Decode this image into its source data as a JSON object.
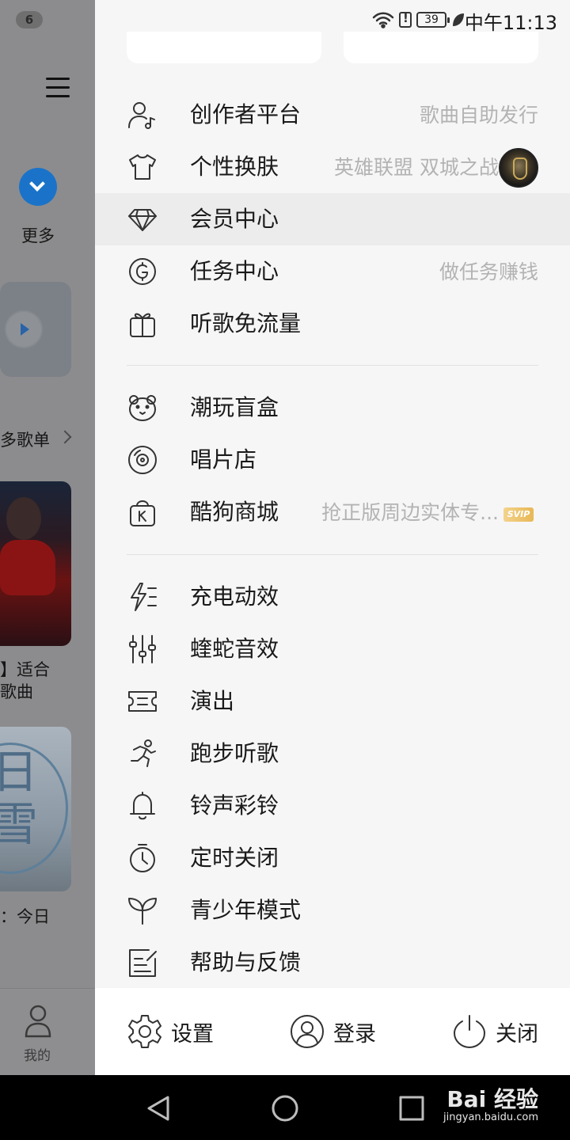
{
  "status_bar": {
    "time": "中午11:13",
    "battery": "39"
  },
  "background_app": {
    "notification_count": "6",
    "more_label": "更多",
    "playlist_header": "多歌单",
    "card1_caption": "】适合\n歌曲",
    "card2_glyphs": "日\n雪",
    "card2_caption": "：今日",
    "tab_me_label": "我的"
  },
  "drawer": {
    "menu_groups": [
      [
        {
          "label": "创作者平台",
          "hint": "歌曲自助发行",
          "icon": "creator-icon"
        },
        {
          "label": "个性换肤",
          "hint": "英雄联盟 双城之战",
          "icon": "shirt-icon",
          "avatar": true
        },
        {
          "label": "会员中心",
          "hint": "",
          "icon": "diamond-icon",
          "highlighted": true
        },
        {
          "label": "任务中心",
          "hint": "做任务赚钱",
          "icon": "coin-icon"
        },
        {
          "label": "听歌免流量",
          "hint": "",
          "icon": "gift-icon"
        }
      ],
      [
        {
          "label": "潮玩盲盒",
          "hint": "",
          "icon": "bear-icon"
        },
        {
          "label": "唱片店",
          "hint": "",
          "icon": "vinyl-icon"
        },
        {
          "label": "酷狗商城",
          "hint": "抢正版周边实体专...",
          "icon": "shop-bag-icon",
          "badge": "SVIP"
        }
      ],
      [
        {
          "label": "充电动效",
          "hint": "",
          "icon": "charge-icon"
        },
        {
          "label": "蝰蛇音效",
          "hint": "",
          "icon": "equalizer-icon"
        },
        {
          "label": "演出",
          "hint": "",
          "icon": "ticket-icon"
        },
        {
          "label": "跑步听歌",
          "hint": "",
          "icon": "running-icon"
        },
        {
          "label": "铃声彩铃",
          "hint": "",
          "icon": "bell-icon"
        },
        {
          "label": "定时关闭",
          "hint": "",
          "icon": "timer-icon"
        },
        {
          "label": "青少年模式",
          "hint": "",
          "icon": "sprout-icon"
        },
        {
          "label": "帮助与反馈",
          "hint": "",
          "icon": "feedback-icon"
        }
      ]
    ],
    "bottom_bar": {
      "settings_label": "设置",
      "login_label": "登录",
      "close_label": "关闭"
    }
  },
  "watermark": {
    "line1": "Bai 经验",
    "line2": "jingyan.baidu.com"
  }
}
